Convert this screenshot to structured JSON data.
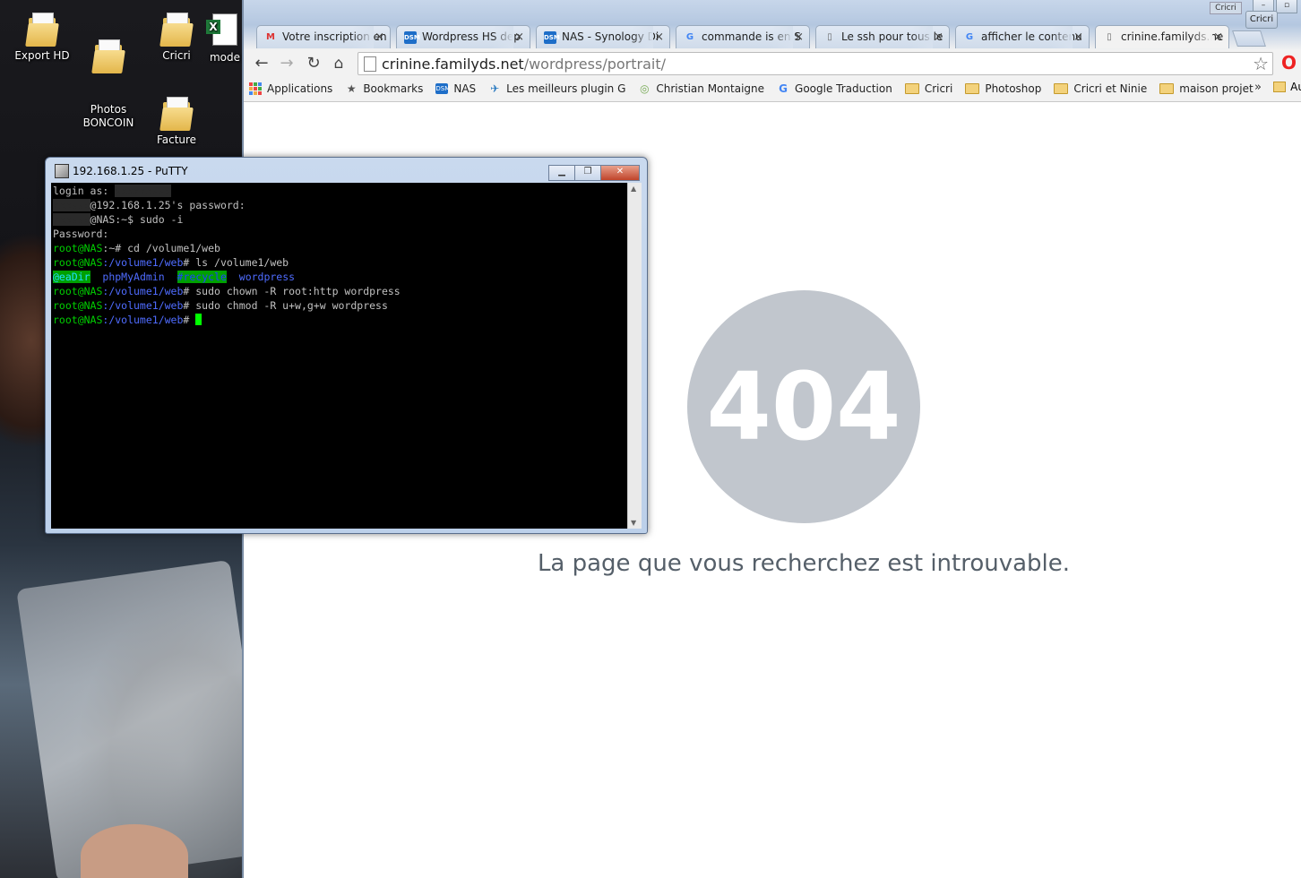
{
  "desktop": {
    "icons": [
      {
        "label": "Export HD",
        "kind": "folder"
      },
      {
        "label": "Photos\nBONCOIN",
        "kind": "folder"
      },
      {
        "label": "Cricri",
        "kind": "folder"
      },
      {
        "label": "mode",
        "kind": "excel"
      },
      {
        "label": "Facture",
        "kind": "folder"
      }
    ]
  },
  "browser": {
    "profile_label": "Cricri",
    "tabs": [
      {
        "title": "Votre inscription en",
        "icon": "gmail-icon"
      },
      {
        "title": "Wordpress HS dep",
        "icon": "dsm-icon"
      },
      {
        "title": "NAS - Synology Di",
        "icon": "dsm-icon"
      },
      {
        "title": "commande is en S",
        "icon": "google-icon"
      },
      {
        "title": "Le ssh pour tous le",
        "icon": "document-icon"
      },
      {
        "title": "afficher le contenu",
        "icon": "google-icon"
      },
      {
        "title": "crinine.familyds.ne",
        "icon": "document-icon",
        "active": true
      }
    ],
    "url": {
      "host": "crinine.familyds.net",
      "path": "/wordpress/portrait/"
    },
    "bookmarks": [
      {
        "label": "Applications",
        "icon": "apps-grid-icon"
      },
      {
        "label": "Bookmarks",
        "icon": "star-icon"
      },
      {
        "label": "NAS",
        "icon": "dsm-icon"
      },
      {
        "label": "Les meilleurs plugin G",
        "icon": "plugin-icon"
      },
      {
        "label": "Christian Montaigne",
        "icon": "circle-icon"
      },
      {
        "label": "Google Traduction",
        "icon": "translate-icon"
      },
      {
        "label": "Cricri",
        "icon": "folder-icon"
      },
      {
        "label": "Photoshop",
        "icon": "folder-icon"
      },
      {
        "label": "Cricri et Ninie",
        "icon": "folder-icon"
      },
      {
        "label": "maison projet",
        "icon": "folder-icon"
      }
    ],
    "bookmarks_overflow": "»",
    "bookmarks_trailing": "Au",
    "page": {
      "error_code": "404",
      "message": "La page que vous recherchez est introuvable."
    }
  },
  "putty": {
    "title": "192.168.1.25 - PuTTY",
    "lines": {
      "l1_prompt": "login as: ",
      "l2_text": "@192.168.1.25's password:",
      "l3_host": "@NAS",
      "l3_rest": ":~$ sudo -i",
      "l4": "Password:",
      "l5_user": "root@NAS",
      "l5_rest": ":~# cd /volume1/web",
      "l6_user": "root@NAS",
      "l6_path": ":/volume1/web",
      "l6_rest": "# ls /volume1/web",
      "l7_a": "@eaDir",
      "l7_b": "phpMyAdmin",
      "l7_c": "#recycle",
      "l7_d": "wordpress",
      "l8_user": "root@NAS",
      "l8_path": ":/volume1/web",
      "l8_rest": "# sudo chown -R root:http wordpress",
      "l9_user": "root@NAS",
      "l9_path": ":/volume1/web",
      "l9_rest": "# sudo chmod -R u+w,g+w wordpress",
      "l10_user": "root@NAS",
      "l10_path": ":/volume1/web",
      "l10_rest": "# "
    }
  },
  "colors": {
    "term_green": "#00d000",
    "term_blue": "#4f6cff",
    "circle_grey": "#c1c6cd",
    "message_text": "#555f69"
  }
}
